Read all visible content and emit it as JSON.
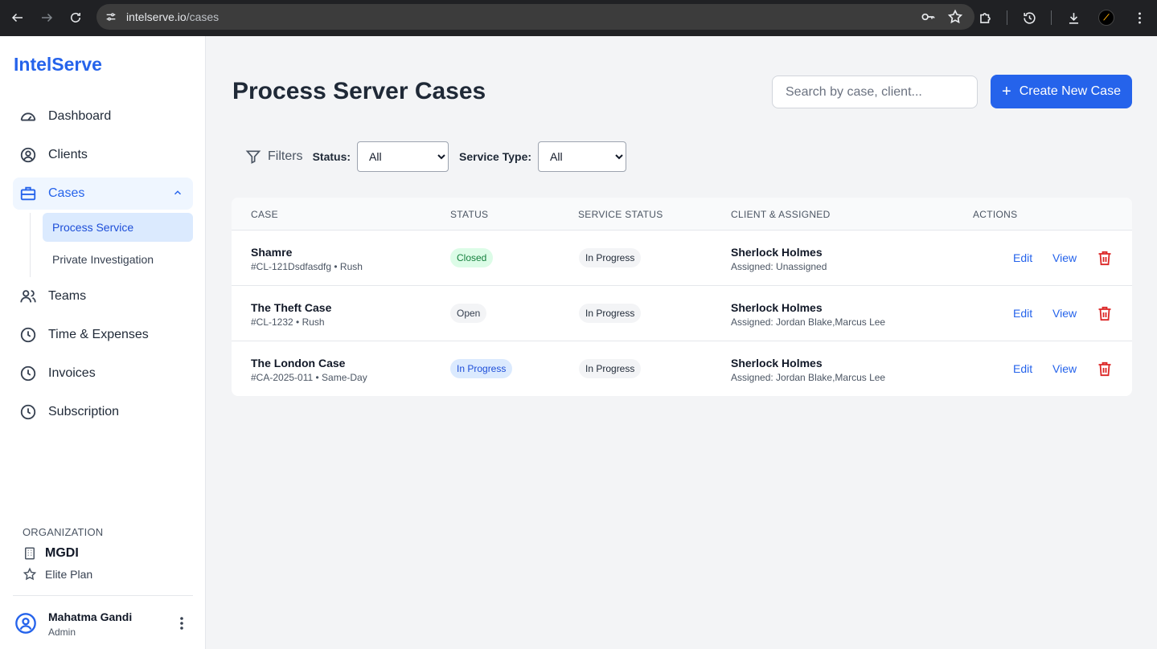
{
  "browser": {
    "url_host": "intelserve.io",
    "url_path": "/cases"
  },
  "sidebar": {
    "brand": "IntelServe",
    "items": [
      {
        "label": "Dashboard",
        "icon": "gauge-icon"
      },
      {
        "label": "Clients",
        "icon": "user-circle-icon"
      },
      {
        "label": "Cases",
        "icon": "briefcase-icon"
      },
      {
        "label": "Teams",
        "icon": "users-icon"
      },
      {
        "label": "Time & Expenses",
        "icon": "clock-icon"
      },
      {
        "label": "Invoices",
        "icon": "clock-icon"
      },
      {
        "label": "Subscription",
        "icon": "clock-icon"
      }
    ],
    "sub_items": [
      {
        "label": "Process Service"
      },
      {
        "label": "Private Investigation"
      }
    ],
    "org_label": "ORGANIZATION",
    "org_name": "MGDI",
    "org_plan": "Elite Plan",
    "user_name": "Mahatma Gandi",
    "user_role": "Admin"
  },
  "main": {
    "title": "Process Server Cases",
    "search_placeholder": "Search by case, client...",
    "create_button": "Create New Case",
    "filters": {
      "label": "Filters",
      "status_label": "Status:",
      "status_value": "All",
      "service_type_label": "Service Type:",
      "service_type_value": "All"
    },
    "table": {
      "headers": [
        "CASE",
        "STATUS",
        "SERVICE STATUS",
        "CLIENT & ASSIGNED",
        "ACTIONS"
      ],
      "rows": [
        {
          "title": "Shamre",
          "sub": "#CL-121Dsdfasdfg • Rush",
          "status": "Closed",
          "service_status": "In Progress",
          "client": "Sherlock Holmes",
          "assigned": "Assigned: Unassigned",
          "edit": "Edit",
          "view": "View"
        },
        {
          "title": "The Theft Case",
          "sub": "#CL-1232 • Rush",
          "status": "Open",
          "service_status": "In Progress",
          "client": "Sherlock Holmes",
          "assigned": "Assigned: Jordan Blake,Marcus Lee",
          "edit": "Edit",
          "view": "View"
        },
        {
          "title": "The London Case",
          "sub": "#CA-2025-011 • Same-Day",
          "status": "In Progress",
          "service_status": "In Progress",
          "client": "Sherlock Holmes",
          "assigned": "Assigned: Jordan Blake,Marcus Lee",
          "edit": "Edit",
          "view": "View"
        }
      ]
    }
  },
  "colors": {
    "accent": "#2563eb",
    "danger": "#dc2626",
    "closed_badge": "#dcfce7",
    "progress_badge": "#dbeafe"
  }
}
